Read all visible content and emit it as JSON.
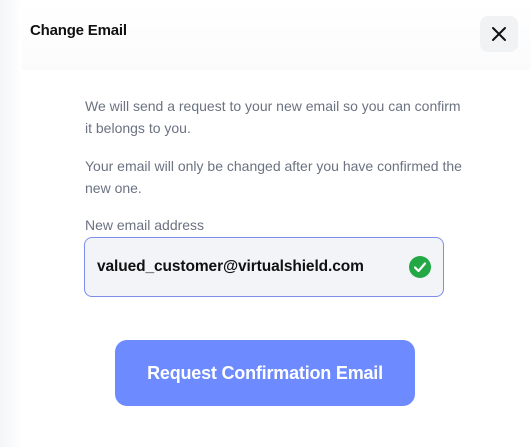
{
  "dialog": {
    "title": "Change Email",
    "close_icon": "close-icon"
  },
  "content": {
    "description_1": "We will send a request to your new email so you can confirm it belongs to you.",
    "description_2": "Your email will only be changed after you have confirmed the new one.",
    "field_label": "New email address",
    "email_value": "valued_customer@virtualshield.com",
    "valid_icon": "check-circle-icon",
    "valid_color": "#22a845",
    "submit_label": "Request Confirmation Email",
    "accent_color": "#6d8bff"
  }
}
